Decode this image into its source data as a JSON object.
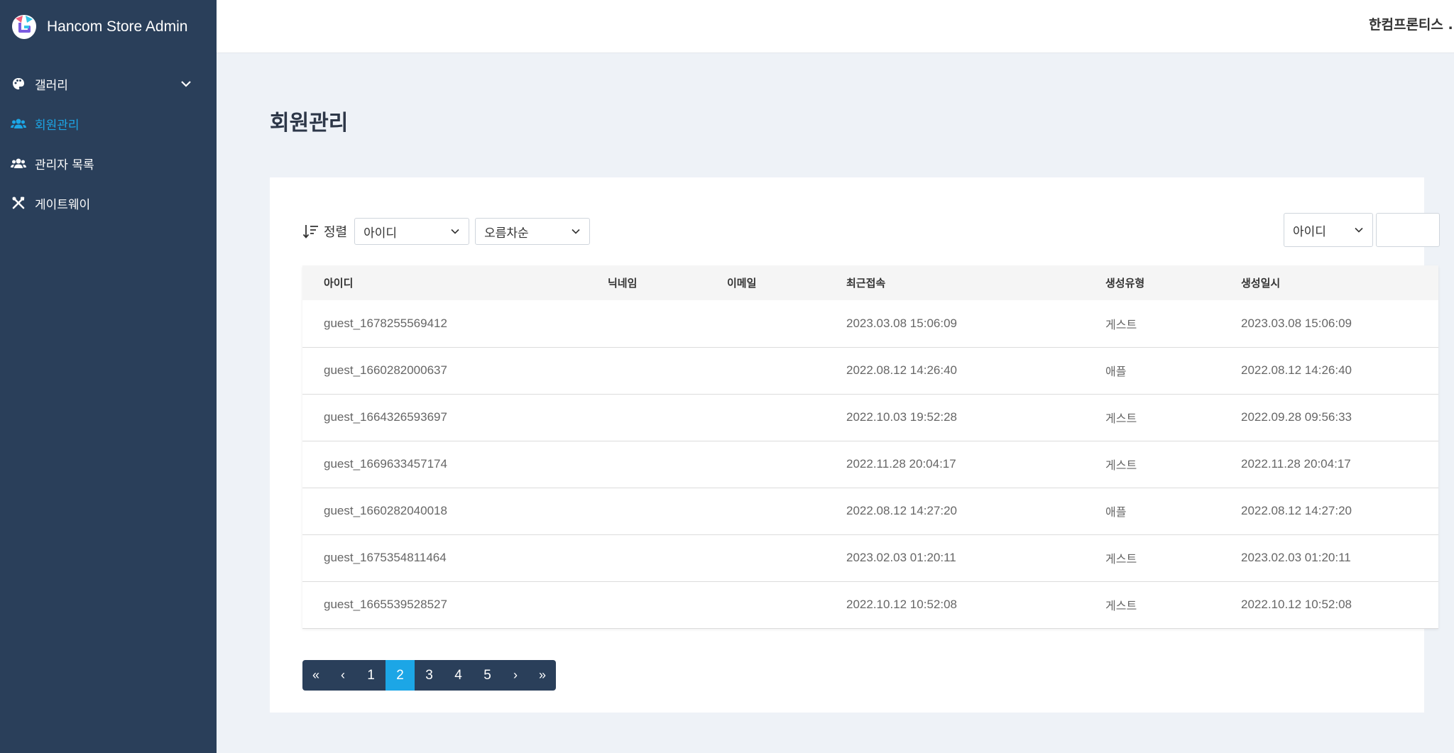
{
  "app": {
    "title": "Hancom Store Admin"
  },
  "sidebar": {
    "items": [
      {
        "label": "갤러리",
        "icon": "palette-icon",
        "active": false,
        "expandable": true
      },
      {
        "label": "회원관리",
        "icon": "users-icon",
        "active": true,
        "expandable": false
      },
      {
        "label": "관리자 목록",
        "icon": "user-group-icon",
        "active": false,
        "expandable": false
      },
      {
        "label": "게이트웨이",
        "icon": "tools-icon",
        "active": false,
        "expandable": false
      }
    ]
  },
  "topbar": {
    "user_label": "한컴프론티스 ..."
  },
  "page": {
    "title": "회원관리"
  },
  "sort": {
    "label": "정렬",
    "field_value": "아이디",
    "order_value": "오름차순"
  },
  "search": {
    "field_value": "아이디",
    "placeholder": ""
  },
  "table": {
    "columns": [
      "아이디",
      "닉네임",
      "이메일",
      "최근접속",
      "생성유형",
      "생성일시"
    ],
    "rows": [
      {
        "id": "guest_1678255569412",
        "nickname": "",
        "email": "",
        "last_access": "2023.03.08 15:06:09",
        "type": "게스트",
        "created": "2023.03.08 15:06:09"
      },
      {
        "id": "guest_1660282000637",
        "nickname": "",
        "email": "",
        "last_access": "2022.08.12 14:26:40",
        "type": "애플",
        "created": "2022.08.12 14:26:40"
      },
      {
        "id": "guest_1664326593697",
        "nickname": "",
        "email": "",
        "last_access": "2022.10.03 19:52:28",
        "type": "게스트",
        "created": "2022.09.28 09:56:33"
      },
      {
        "id": "guest_1669633457174",
        "nickname": "",
        "email": "",
        "last_access": "2022.11.28 20:04:17",
        "type": "게스트",
        "created": "2022.11.28 20:04:17"
      },
      {
        "id": "guest_1660282040018",
        "nickname": "",
        "email": "",
        "last_access": "2022.08.12 14:27:20",
        "type": "애플",
        "created": "2022.08.12 14:27:20"
      },
      {
        "id": "guest_1675354811464",
        "nickname": "",
        "email": "",
        "last_access": "2023.02.03 01:20:11",
        "type": "게스트",
        "created": "2023.02.03 01:20:11"
      },
      {
        "id": "guest_1665539528527",
        "nickname": "",
        "email": "",
        "last_access": "2022.10.12 10:52:08",
        "type": "게스트",
        "created": "2022.10.12 10:52:08"
      }
    ]
  },
  "pagination": {
    "first": "«",
    "prev": "‹",
    "pages": [
      "1",
      "2",
      "3",
      "4",
      "5"
    ],
    "current": "2",
    "next": "›",
    "last": "»"
  },
  "colors": {
    "sidebar_bg": "#2a3f5a",
    "accent": "#1ca6e6",
    "page_bg": "#eef2f7"
  }
}
